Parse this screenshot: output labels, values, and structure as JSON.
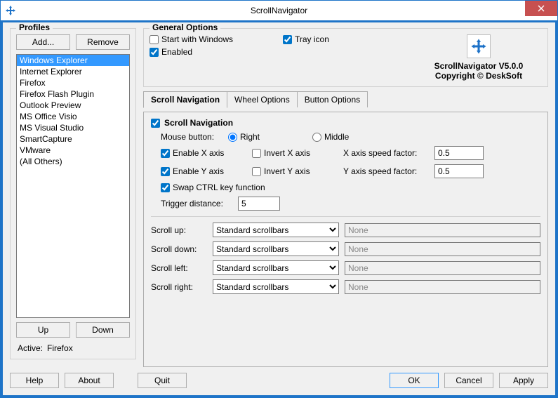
{
  "window": {
    "title": "ScrollNavigator"
  },
  "profiles": {
    "legend": "Profiles",
    "add_label": "Add...",
    "remove_label": "Remove",
    "items": [
      "Windows Explorer",
      "Internet Explorer",
      "Firefox",
      "Firefox Flash Plugin",
      "Outlook Preview",
      "MS Office Visio",
      "MS Visual Studio",
      "SmartCapture",
      "VMware",
      "(All Others)"
    ],
    "selected_index": 0,
    "up_label": "Up",
    "down_label": "Down",
    "active_label": "Active:",
    "active_value": "Firefox"
  },
  "general": {
    "legend": "General Options",
    "start_with_windows": {
      "label": "Start with Windows",
      "checked": false
    },
    "tray_icon": {
      "label": "Tray icon",
      "checked": true
    },
    "enabled": {
      "label": "Enabled",
      "checked": true
    }
  },
  "brand": {
    "line1": "ScrollNavigator V5.0.0",
    "line2": "Copyright © DeskSoft"
  },
  "tabs": {
    "items": [
      "Scroll Navigation",
      "Wheel Options",
      "Button Options"
    ],
    "active_index": 0
  },
  "scrollnav": {
    "section_label": "Scroll Navigation",
    "section_checked": true,
    "mouse_button_label": "Mouse button:",
    "mouse_button_right": "Right",
    "mouse_button_middle": "Middle",
    "mouse_button_value": "Right",
    "enable_x": {
      "label": "Enable X axis",
      "checked": true
    },
    "invert_x": {
      "label": "Invert X axis",
      "checked": false
    },
    "x_speed_label": "X axis speed factor:",
    "x_speed_value": "0.5",
    "enable_y": {
      "label": "Enable Y axis",
      "checked": true
    },
    "invert_y": {
      "label": "Invert Y axis",
      "checked": false
    },
    "y_speed_label": "Y axis speed factor:",
    "y_speed_value": "0.5",
    "swap_ctrl": {
      "label": "Swap CTRL key function",
      "checked": true
    },
    "trigger_label": "Trigger distance:",
    "trigger_value": "5",
    "scroll_up_label": "Scroll up:",
    "scroll_down_label": "Scroll down:",
    "scroll_left_label": "Scroll left:",
    "scroll_right_label": "Scroll right:",
    "scroll_option": "Standard scrollbars",
    "scroll_extra_placeholder": "None"
  },
  "buttons": {
    "help": "Help",
    "about": "About",
    "quit": "Quit",
    "ok": "OK",
    "cancel": "Cancel",
    "apply": "Apply"
  }
}
